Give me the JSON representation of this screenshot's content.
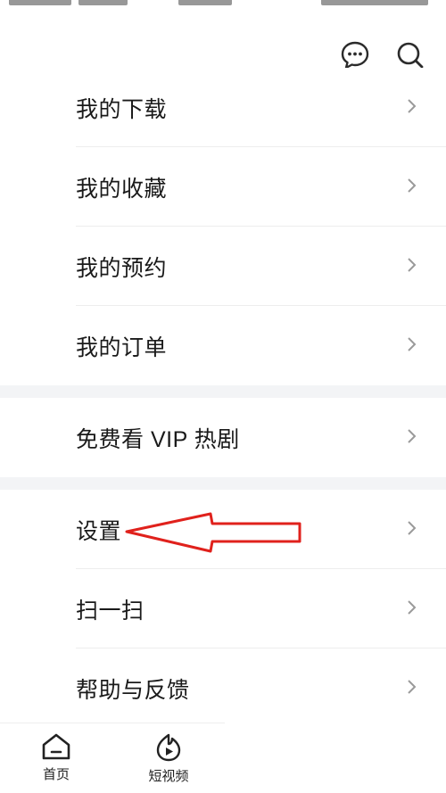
{
  "menu": {
    "group1": [
      {
        "label": "我的下载"
      },
      {
        "label": "我的收藏"
      },
      {
        "label": "我的预约"
      },
      {
        "label": "我的订单"
      }
    ],
    "group2": [
      {
        "label": "免费看 VIP 热剧"
      }
    ],
    "group3": [
      {
        "label": "设置"
      },
      {
        "label": "扫一扫"
      },
      {
        "label": "帮助与反馈"
      }
    ]
  },
  "tabbar": {
    "home": "首页",
    "short_video": "短视频"
  },
  "colors": {
    "annotation_arrow": "#e0211c",
    "section_gap": "#f3f4f6"
  },
  "icons": {
    "top": [
      "message-icon",
      "search-icon"
    ],
    "row": "chevron-right-icon"
  }
}
